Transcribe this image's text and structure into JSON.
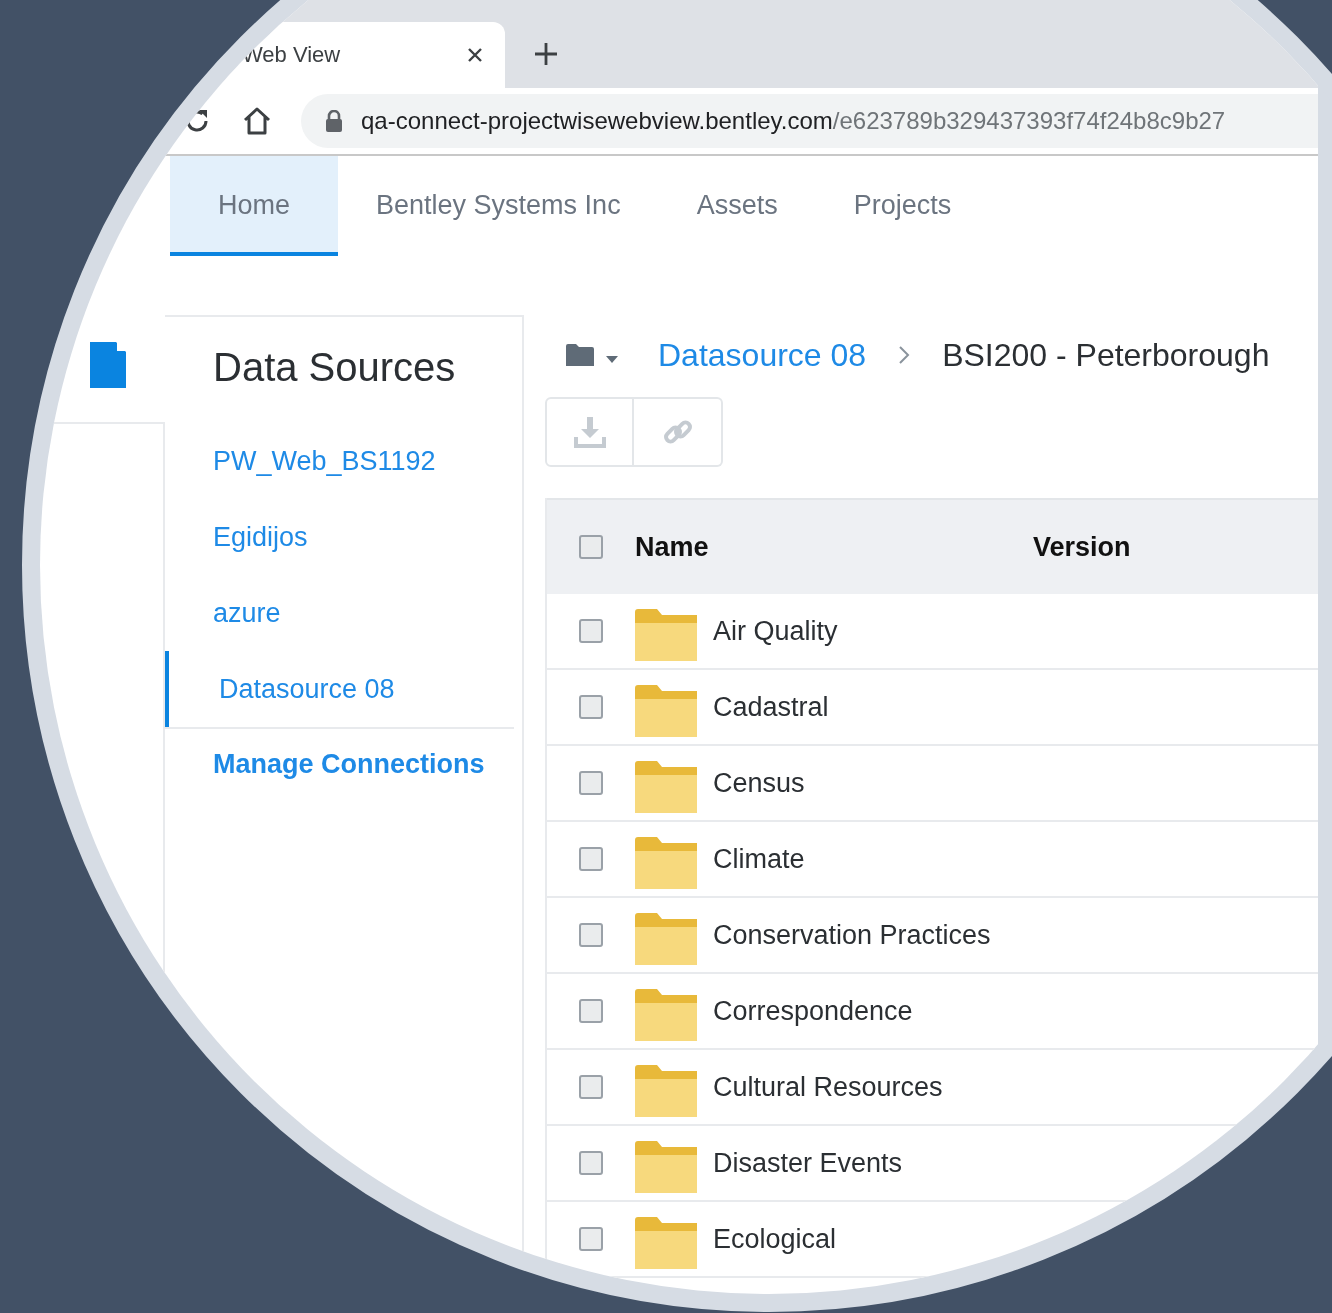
{
  "browser": {
    "tab": {
      "title": "Web View"
    },
    "address": {
      "host": "qa-connect-projectwisewebview.bentley.com",
      "path": "/e623789b329437393f74f24b8c9b27"
    }
  },
  "nav": [
    {
      "label": "Home",
      "selected": true
    },
    {
      "label": "Bentley Systems Inc",
      "selected": false
    },
    {
      "label": "Assets",
      "selected": false
    },
    {
      "label": "Projects",
      "selected": false
    }
  ],
  "sidebar": {
    "title": "Data Sources",
    "items": [
      {
        "label": "PW_Web_BS1192",
        "selected": false
      },
      {
        "label": "Egidijos",
        "selected": false
      },
      {
        "label": "azure",
        "selected": false
      },
      {
        "label": "Datasource 08",
        "selected": true
      }
    ],
    "manage_link": "Manage Connections"
  },
  "breadcrumb": [
    {
      "label": "Datasource 08",
      "kind": "link"
    },
    {
      "label": "BSI200 - Peterborough",
      "kind": "current"
    }
  ],
  "table": {
    "columns": [
      "Name",
      "Version"
    ],
    "header_checked": false,
    "rows": [
      {
        "name": "Air Quality",
        "checked": false
      },
      {
        "name": "Cadastral",
        "checked": false
      },
      {
        "name": "Census",
        "checked": false
      },
      {
        "name": "Climate",
        "checked": false
      },
      {
        "name": "Conservation Practices",
        "checked": false
      },
      {
        "name": "Correspondence",
        "checked": false
      },
      {
        "name": "Cultural Resources",
        "checked": false
      },
      {
        "name": "Disaster Events",
        "checked": false
      },
      {
        "name": "Ecological",
        "checked": false
      }
    ]
  }
}
